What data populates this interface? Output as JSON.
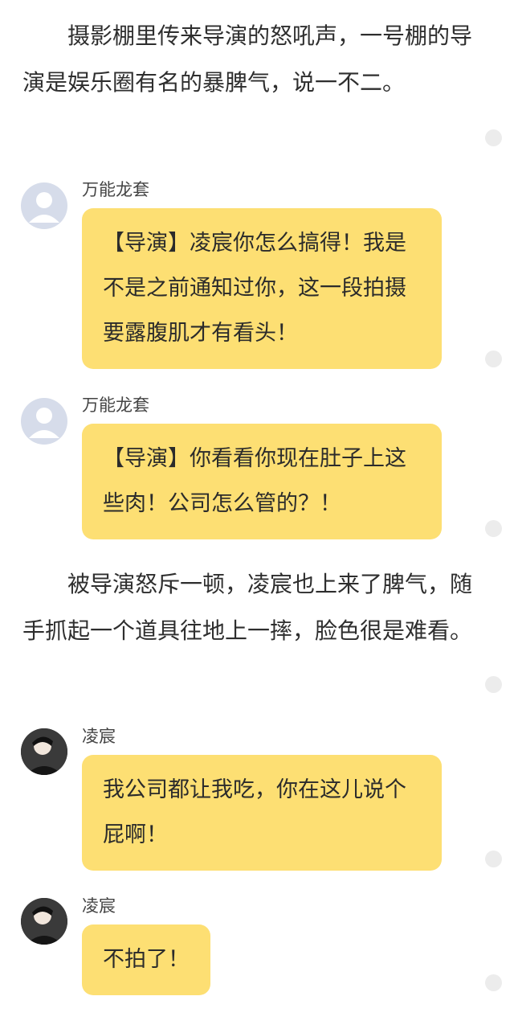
{
  "blocks": [
    {
      "type": "narration",
      "text": "摄影棚里传来导演的怒吼声，一号棚的导演是娱乐圈有名的暴脾气，说一不二。"
    },
    {
      "type": "message",
      "speaker": "万能龙套",
      "avatar": "default-avatar-icon",
      "text": "【导演】凌宸你怎么搞得！我是不是之前通知过你，这一段拍摄要露腹肌才有看头！"
    },
    {
      "type": "message",
      "speaker": "万能龙套",
      "avatar": "default-avatar-icon",
      "text": "【导演】你看看你现在肚子上这些肉！公司怎么管的？！"
    },
    {
      "type": "narration",
      "text": "被导演怒斥一顿，凌宸也上来了脾气，随手抓起一个道具往地上一摔，脸色很是难看。"
    },
    {
      "type": "message",
      "speaker": "凌宸",
      "avatar": "character-photo-avatar",
      "text": "我公司都让我吃，你在这儿说个屁啊！"
    },
    {
      "type": "message",
      "speaker": "凌宸",
      "avatar": "character-photo-avatar",
      "text": "不拍了！"
    }
  ],
  "colors": {
    "bubble": "#fddf73",
    "side_dot": "#ececec",
    "default_avatar_bg": "#d6dcea"
  }
}
